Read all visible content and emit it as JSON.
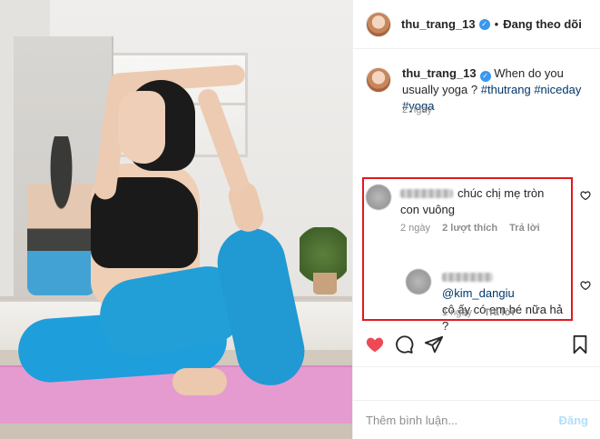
{
  "post": {
    "username": "thu_trang_13",
    "follow_status": "Đang theo dõi",
    "caption_text": "When do you usually yoga ?",
    "hashtags": [
      "#thutrang",
      "#niceday",
      "#yoga"
    ],
    "caption_time": "2 ngày"
  },
  "comments": [
    {
      "text": "chúc chị mẹ tròn con vuông",
      "time": "2 ngày",
      "likes": "2 lượt thích",
      "reply": "Trả lời"
    },
    {
      "mention": "@kim_dangiu",
      "text": "cô ấy có em bé nữa hả ?",
      "time": "1 ngày",
      "reply": "Trả lời"
    }
  ],
  "composer": {
    "placeholder": "Thêm bình luận...",
    "post_label": "Đăng"
  },
  "icons": {
    "like": "heart-icon",
    "comment": "comment-bubble-icon",
    "share": "paper-plane-icon",
    "save": "bookmark-icon",
    "verified": "verified-badge-icon"
  },
  "colors": {
    "like_active": "#ed4956",
    "link": "#00376b",
    "verified": "#3897f0",
    "highlight_box": "#e0191f",
    "post_disabled": "#b2dffc"
  }
}
